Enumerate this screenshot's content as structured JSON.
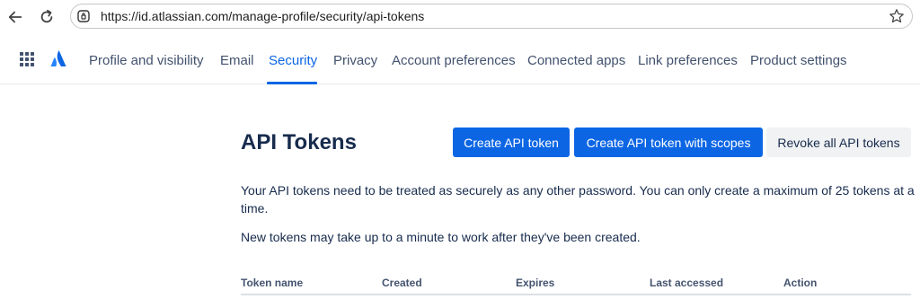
{
  "browser": {
    "url": "https://id.atlassian.com/manage-profile/security/api-tokens"
  },
  "nav": {
    "items": [
      {
        "label": "Profile and visibility"
      },
      {
        "label": "Email"
      },
      {
        "label": "Security"
      },
      {
        "label": "Privacy"
      },
      {
        "label": "Account preferences"
      },
      {
        "label": "Connected apps"
      },
      {
        "label": "Link preferences"
      },
      {
        "label": "Product settings"
      }
    ],
    "active": "Security"
  },
  "page": {
    "title": "API Tokens",
    "buttons": {
      "create": "Create API token",
      "create_scoped": "Create API token with scopes",
      "revoke_all": "Revoke all API tokens"
    },
    "description": "Your API tokens need to be treated as securely as any other password. You can only create a maximum of 25 tokens at a time.",
    "note": "New tokens may take up to a minute to work after they've been created."
  },
  "table": {
    "columns": [
      "Token name",
      "Created",
      "Expires",
      "Last accessed",
      "Action"
    ]
  },
  "colors": {
    "primary": "#0c66e4",
    "text": "#172b4d",
    "nav_text": "#42526e"
  }
}
